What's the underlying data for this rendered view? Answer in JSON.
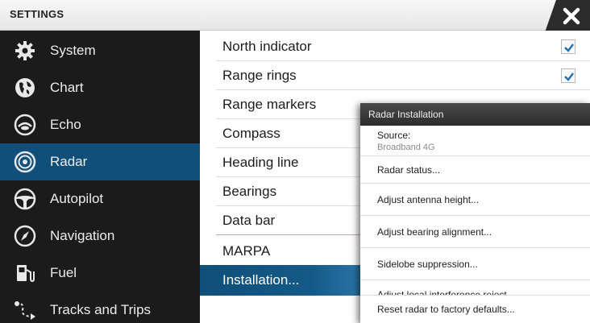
{
  "window": {
    "title": "SETTINGS",
    "close_icon": "close-icon"
  },
  "sidebar": {
    "items": [
      {
        "label": "System",
        "icon": "gear-icon"
      },
      {
        "label": "Chart",
        "icon": "chart-globe-icon"
      },
      {
        "label": "Echo",
        "icon": "echo-icon"
      },
      {
        "label": "Radar",
        "icon": "radar-icon",
        "active": true
      },
      {
        "label": "Autopilot",
        "icon": "steering-wheel-icon"
      },
      {
        "label": "Navigation",
        "icon": "compass-icon"
      },
      {
        "label": "Fuel",
        "icon": "fuel-pump-icon"
      },
      {
        "label": "Tracks and Trips",
        "icon": "track-icon"
      }
    ]
  },
  "options": {
    "items": [
      {
        "label": "North indicator",
        "checked": true
      },
      {
        "label": "Range rings",
        "checked": true
      },
      {
        "label": "Range markers"
      },
      {
        "label": "Compass"
      },
      {
        "label": "Heading line"
      },
      {
        "label": "Bearings"
      },
      {
        "label": "Data bar"
      },
      {
        "label": "MARPA"
      },
      {
        "label": "Installation...",
        "selected": true
      }
    ]
  },
  "dialog": {
    "title": "Radar Installation",
    "source_label": "Source:",
    "source_value": "Broadband 4G",
    "items": [
      "Radar status...",
      "Adjust antenna height...",
      "Adjust bearing alignment...",
      "Sidelobe suppression...",
      "Adjust local interference reject...",
      "Reset radar to factory defaults..."
    ]
  },
  "colors": {
    "accent": "#0f4f79",
    "sidebar_bg": "#1b1b1b",
    "checkmark": "#1f6fb2"
  }
}
